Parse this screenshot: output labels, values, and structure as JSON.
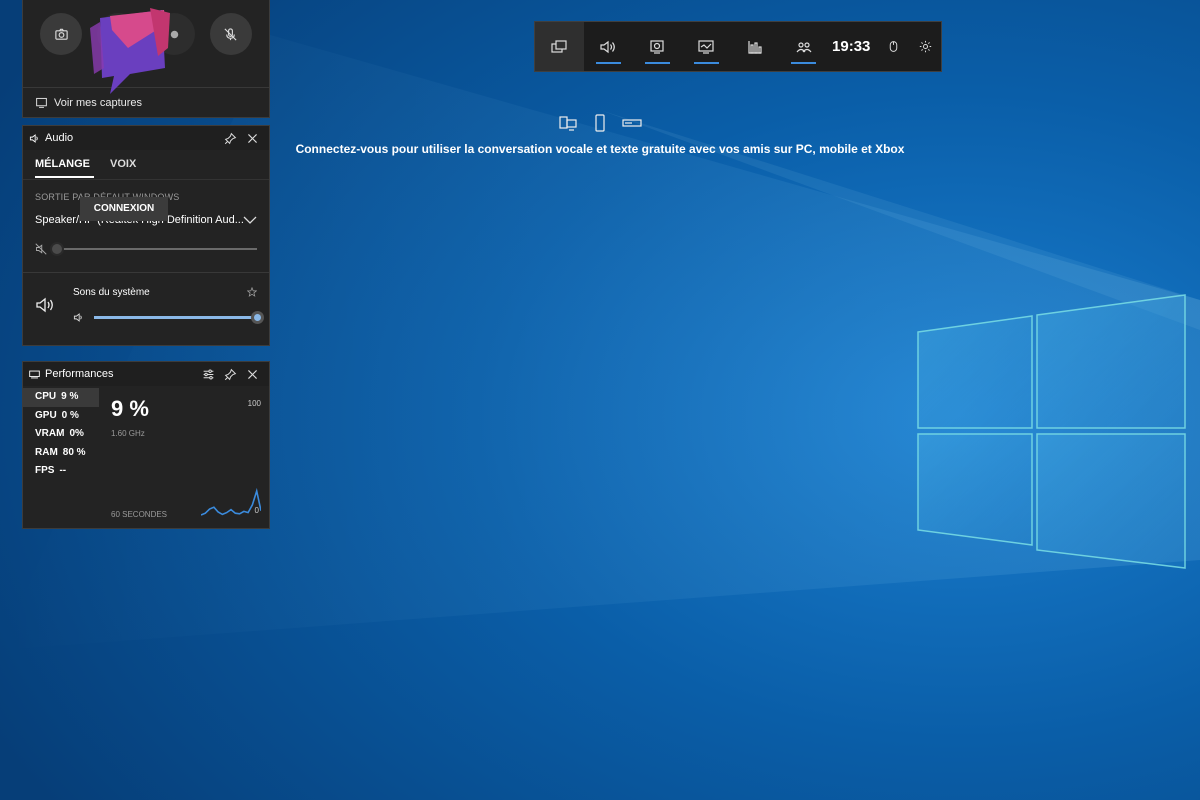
{
  "capture": {
    "buttons": [
      "camera-icon",
      "record-last-icon",
      "record-dot-icon",
      "mic-off-icon"
    ],
    "footer_label": "Voir mes captures"
  },
  "audio": {
    "title": "Audio",
    "tabs": [
      "MÉLANGE",
      "VOIX"
    ],
    "active_tab": 0,
    "output_section_label": "SORTIE PAR DÉFAUT WINDOWS",
    "device_name": "Speaker/HP (Realtek High Definition Aud...",
    "device_muted": true,
    "device_volume": 0,
    "app_name": "Sons du système",
    "app_volume": 100
  },
  "performance": {
    "title": "Performances",
    "metrics": [
      {
        "label": "CPU",
        "value": "9 %"
      },
      {
        "label": "GPU",
        "value": "0 %"
      },
      {
        "label": "VRAM",
        "value": "0%"
      },
      {
        "label": "RAM",
        "value": "80 %"
      },
      {
        "label": "FPS",
        "value": "--"
      }
    ],
    "active_metric": "CPU",
    "big_value": "9 %",
    "frequency": "1.60 GHz",
    "y_max": "100",
    "y_min": "0",
    "x_label": "60 SECONDES",
    "history": [
      5,
      8,
      15,
      18,
      10,
      6,
      9,
      14,
      8,
      7,
      11,
      9,
      22,
      45,
      12
    ]
  },
  "social": {
    "message": "Connectez-vous pour utiliser la conversation vocale et texte gratuite avec vos amis sur PC, mobile et Xbox",
    "connect_label": "CONNEXION"
  },
  "gamebar": {
    "clock": "19:33",
    "buttons": [
      {
        "icon": "widget-menu-icon",
        "active": false
      },
      {
        "icon": "audio-icon",
        "active": true
      },
      {
        "icon": "capture-icon",
        "active": true
      },
      {
        "icon": "performance-icon",
        "active": true
      },
      {
        "icon": "resources-icon",
        "active": false
      },
      {
        "icon": "social-icon",
        "active": true
      }
    ]
  },
  "colors": {
    "accent": "#3b8bdd",
    "panel": "#232323",
    "desktop": "#0a4f8c"
  }
}
